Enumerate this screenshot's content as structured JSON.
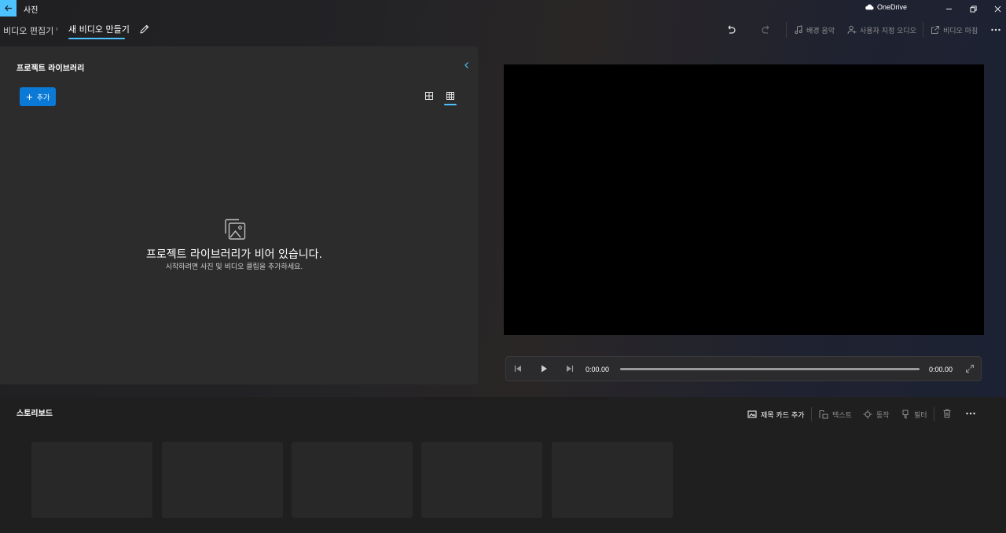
{
  "titlebar": {
    "app_title": "사진",
    "onedrive_label": "OneDrive",
    "accent_color": "#4cc2ff"
  },
  "nav": {
    "breadcrumb_parent": "비디오 편집기",
    "breadcrumb_separator": "›",
    "breadcrumb_current": "새 비디오 만들기",
    "tools": {
      "background_music": "배경 음악",
      "custom_audio": "사용자 지정 오디오",
      "finish_video": "비디오 마침"
    }
  },
  "library": {
    "title": "프로젝트 라이브러리",
    "add_label": "추가",
    "empty_title": "프로젝트 라이브러리가 비어 있습니다.",
    "empty_subtitle": "시작하려면 사진 및 비디오 클립을 추가하세요.",
    "add_button_color": "#0a7ad6"
  },
  "player": {
    "current_time": "0:00.00",
    "total_time": "0:00.00",
    "progress": 0
  },
  "storyboard": {
    "title": "스토리보드",
    "tools": {
      "add_title_card": "제목 카드 추가",
      "text": "텍스트",
      "motion": "동작",
      "filters": "필터"
    },
    "slot_count": 5
  }
}
